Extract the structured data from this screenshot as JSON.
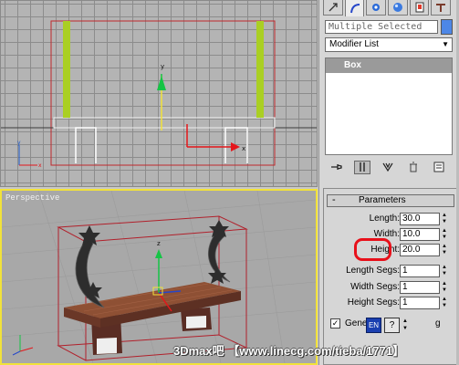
{
  "viewports": {
    "top": {
      "label": ""
    },
    "perspective": {
      "label": "Perspective"
    }
  },
  "command_panel": {
    "tabs": [
      {
        "icon": "create-icon"
      },
      {
        "icon": "modify-icon"
      },
      {
        "icon": "hierarchy-icon"
      },
      {
        "icon": "motion-icon"
      },
      {
        "icon": "display-icon"
      },
      {
        "icon": "utilities-icon"
      }
    ],
    "selection_name": "Multiple Selected",
    "selection_color": "#4d87e6",
    "modifier_list": "Modifier List",
    "stack_items": [
      "Box"
    ],
    "stack_tools": [
      {
        "icon": "pin-stack-icon"
      },
      {
        "icon": "show-end-result-icon"
      },
      {
        "icon": "make-unique-icon"
      },
      {
        "icon": "remove-modifier-icon"
      },
      {
        "icon": "configure-modifier-sets-icon"
      }
    ]
  },
  "parameters": {
    "title": "Parameters",
    "collapse": "-",
    "rows": [
      {
        "label": "Length:",
        "value": "30.0"
      },
      {
        "label": "Width:",
        "value": "10.0"
      },
      {
        "label": "Height:",
        "value": "20.0"
      },
      {
        "label": "Length Segs:",
        "value": "1"
      },
      {
        "label": "Width Segs:",
        "value": "1"
      },
      {
        "label": "Height Segs:",
        "value": "1"
      }
    ],
    "generate_label": "Gene",
    "generate_tail": "g",
    "generate_checked": "✓",
    "highlight_color": "#e8101a"
  },
  "ime": {
    "lang": "EN",
    "help": "?"
  },
  "watermark": "3Dmax吧 【www.linecg.com/tieba/1771】"
}
